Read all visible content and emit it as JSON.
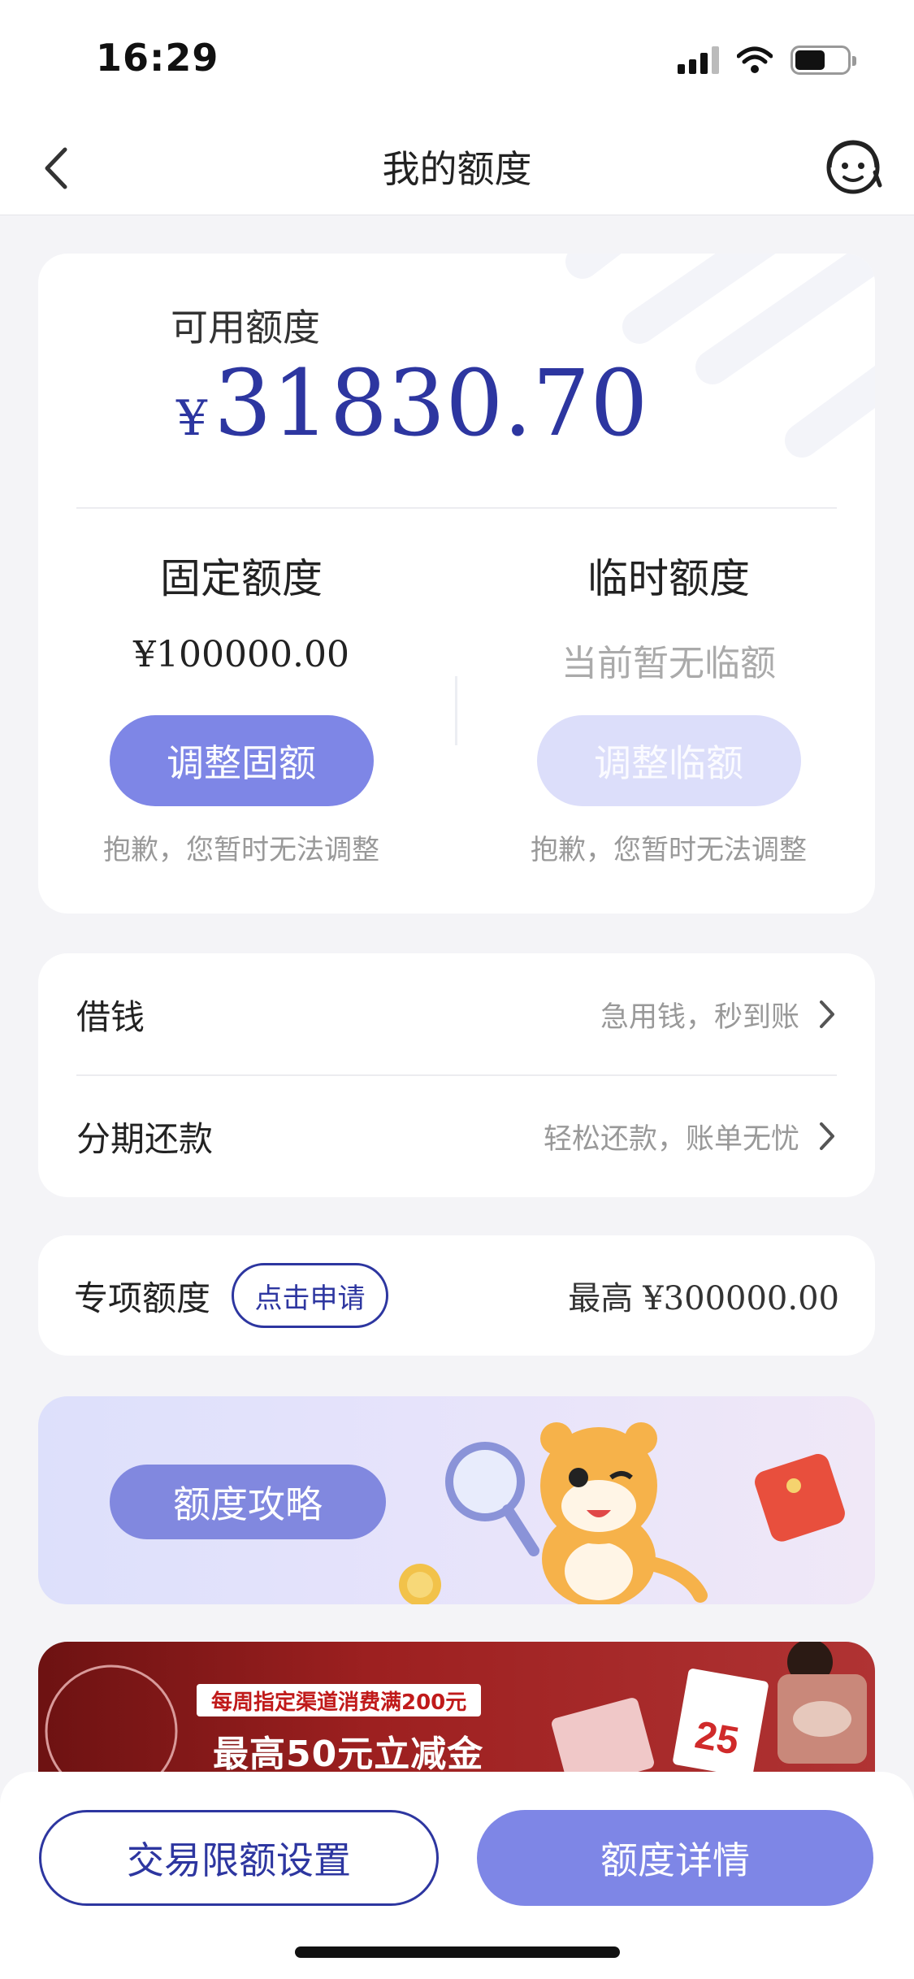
{
  "status_bar": {
    "time": "16:29"
  },
  "nav": {
    "title": "我的额度"
  },
  "quota": {
    "available_label": "可用额度",
    "currency_symbol": "¥",
    "available_amount": "31830.70",
    "fixed": {
      "title": "固定额度",
      "value": "¥100000.00",
      "button": "调整固额",
      "note": "抱歉，您暂时无法调整"
    },
    "temporary": {
      "title": "临时额度",
      "value": "当前暂无临额",
      "button": "调整临额",
      "note": "抱歉，您暂时无法调整"
    }
  },
  "menu": {
    "items": [
      {
        "label": "借钱",
        "hint": "急用钱，秒到账"
      },
      {
        "label": "分期还款",
        "hint": "轻松还款，账单无忧"
      }
    ]
  },
  "special": {
    "label": "专项额度",
    "apply_button": "点击申请",
    "max_prefix": "最高",
    "max_value": "¥300000.00"
  },
  "banners": {
    "guide_button": "额度攻略",
    "promo_tag": "每周指定渠道消费满200元",
    "promo_main": "最高50元立减金"
  },
  "bottom": {
    "limit_button": "交易限额设置",
    "detail_button": "额度详情"
  },
  "colors": {
    "brand": "#2d36a0",
    "accent": "#7e86e6",
    "background": "#f4f4f7"
  }
}
